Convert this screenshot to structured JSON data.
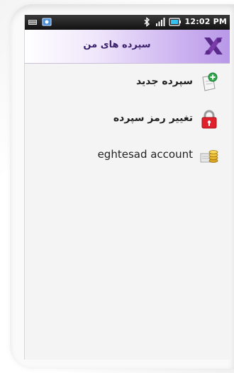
{
  "status_bar": {
    "time": "12:02 PM",
    "icons": [
      "notification-icon",
      "image-icon",
      "bluetooth-icon",
      "signal-icon",
      "battery-icon"
    ]
  },
  "header": {
    "title": "سپرده های من",
    "logo_icon": "bank-logo-icon",
    "accent_color": "#b898e8"
  },
  "menu": {
    "items": [
      {
        "label": "سپرده جدید",
        "icon": "new-document-plus-icon"
      },
      {
        "label": "تغییر رمز سپرده",
        "icon": "lock-icon"
      },
      {
        "label": "eghtesad account",
        "icon": "account-coins-icon"
      }
    ]
  }
}
